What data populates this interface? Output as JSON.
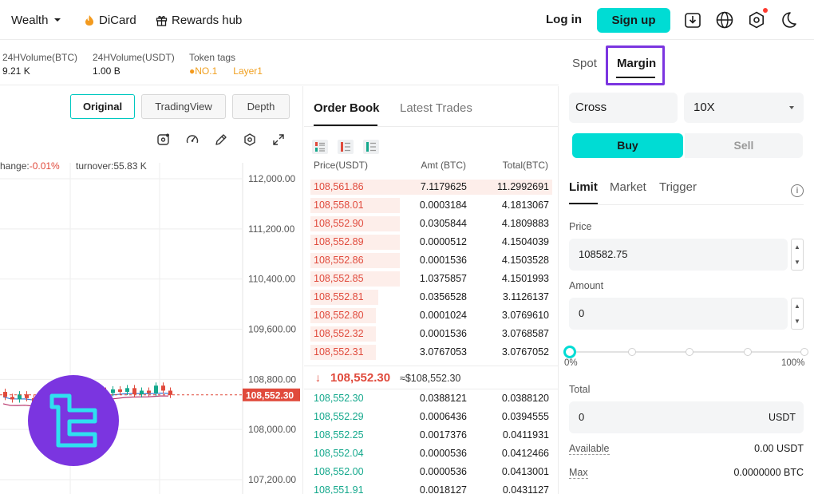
{
  "nav": {
    "wealth": "Wealth",
    "dicard": "DiCard",
    "rewards": "Rewards hub",
    "login": "Log in",
    "signup": "Sign up",
    "icons": [
      "download-icon",
      "globe-icon",
      "settings-icon",
      "moon-icon"
    ]
  },
  "ticker": {
    "vol_btc_label": "24HVolume(BTC)",
    "vol_btc": "9.21 K",
    "vol_usdt_label": "24HVolume(USDT)",
    "vol_usdt": "1.00 B",
    "tags_label": "Token tags",
    "tag1": "NO.1",
    "tag2": "Layer1"
  },
  "chart": {
    "views": [
      "Original",
      "TradingView",
      "Depth"
    ],
    "change_label": "hange:",
    "change_value": "-0.01%",
    "turnover": "turnover:55.83 K",
    "y_ticks": [
      "112,000.00",
      "111,200.00",
      "110,400.00",
      "109,600.00",
      "108,800.00",
      "108,000.00",
      "107,200.00"
    ],
    "last_price_tag": "108,552.30",
    "colors": {
      "up": "#14a88c",
      "down": "#e04a3c",
      "ma1": "#3c7cd8",
      "ma2": "#b8336a"
    }
  },
  "chart_data": {
    "type": "line",
    "title": "",
    "ylim": [
      107200,
      112000
    ],
    "y_ticks": [
      112000,
      111200,
      110400,
      109600,
      108800,
      108000,
      107200
    ],
    "last_price": 108552.3,
    "candles": [
      {
        "o": 108600,
        "c": 108520
      },
      {
        "o": 108520,
        "c": 108480
      },
      {
        "o": 108480,
        "c": 108560
      },
      {
        "o": 108560,
        "c": 108500
      },
      {
        "o": 108500,
        "c": 108420
      },
      {
        "o": 108420,
        "c": 108460
      },
      {
        "o": 108460,
        "c": 108380
      },
      {
        "o": 108380,
        "c": 108440
      },
      {
        "o": 108440,
        "c": 108520
      },
      {
        "o": 108520,
        "c": 108480
      },
      {
        "o": 108480,
        "c": 108540
      },
      {
        "o": 108540,
        "c": 108600
      },
      {
        "o": 108600,
        "c": 108560
      },
      {
        "o": 108560,
        "c": 108620
      },
      {
        "o": 108620,
        "c": 108580
      },
      {
        "o": 108580,
        "c": 108640
      },
      {
        "o": 108640,
        "c": 108600
      },
      {
        "o": 108600,
        "c": 108660
      },
      {
        "o": 108660,
        "c": 108560
      },
      {
        "o": 108560,
        "c": 108620
      },
      {
        "o": 108620,
        "c": 108580
      },
      {
        "o": 108580,
        "c": 108700
      },
      {
        "o": 108700,
        "c": 108620
      },
      {
        "o": 108620,
        "c": 108552
      }
    ]
  },
  "orderbook": {
    "tab_orderbook": "Order Book",
    "tab_trades": "Latest Trades",
    "head_price": "Price(USDT)",
    "head_amt": "Amt (BTC)",
    "head_total": "Total(BTC)",
    "asks": [
      {
        "p": "108,561.86",
        "a": "7.1179625",
        "t": "11.2992691",
        "depth": 1.0
      },
      {
        "p": "108,558.01",
        "a": "0.0003184",
        "t": "4.1813067",
        "depth": 0.37
      },
      {
        "p": "108,552.90",
        "a": "0.0305844",
        "t": "4.1809883",
        "depth": 0.37
      },
      {
        "p": "108,552.89",
        "a": "0.0000512",
        "t": "4.1504039",
        "depth": 0.37
      },
      {
        "p": "108,552.86",
        "a": "0.0001536",
        "t": "4.1503528",
        "depth": 0.37
      },
      {
        "p": "108,552.85",
        "a": "1.0375857",
        "t": "4.1501993",
        "depth": 0.37
      },
      {
        "p": "108,552.81",
        "a": "0.0356528",
        "t": "3.1126137",
        "depth": 0.28
      },
      {
        "p": "108,552.80",
        "a": "0.0001024",
        "t": "3.0769610",
        "depth": 0.27
      },
      {
        "p": "108,552.32",
        "a": "0.0001536",
        "t": "3.0768587",
        "depth": 0.27
      },
      {
        "p": "108,552.31",
        "a": "3.0767053",
        "t": "3.0767052",
        "depth": 0.27
      }
    ],
    "last_price": "108,552.30",
    "approx": "≈$108,552.30",
    "bids": [
      {
        "p": "108,552.30",
        "a": "0.0388121",
        "t": "0.0388120"
      },
      {
        "p": "108,552.29",
        "a": "0.0006436",
        "t": "0.0394555"
      },
      {
        "p": "108,552.25",
        "a": "0.0017376",
        "t": "0.0411931"
      },
      {
        "p": "108,552.04",
        "a": "0.0000536",
        "t": "0.0412466"
      },
      {
        "p": "108,552.00",
        "a": "0.0000536",
        "t": "0.0413001"
      },
      {
        "p": "108,551.91",
        "a": "0.0018127",
        "t": "0.0431127"
      }
    ]
  },
  "trade": {
    "tab_spot": "Spot",
    "tab_margin": "Margin",
    "mode": "Cross",
    "leverage": "10X",
    "buy": "Buy",
    "sell": "Sell",
    "order_limit": "Limit",
    "order_market": "Market",
    "order_trigger": "Trigger",
    "price_label": "Price",
    "price_value": "108582.75",
    "amount_label": "Amount",
    "amount_value": "0",
    "pct_min": "0%",
    "pct_max": "100%",
    "slider_level": 0,
    "total_label": "Total",
    "total_value": "0",
    "total_unit": "USDT",
    "available_label": "Available",
    "available_value": "0.00 USDT",
    "max_label": "Max",
    "max_value": "0.0000000 BTC"
  }
}
